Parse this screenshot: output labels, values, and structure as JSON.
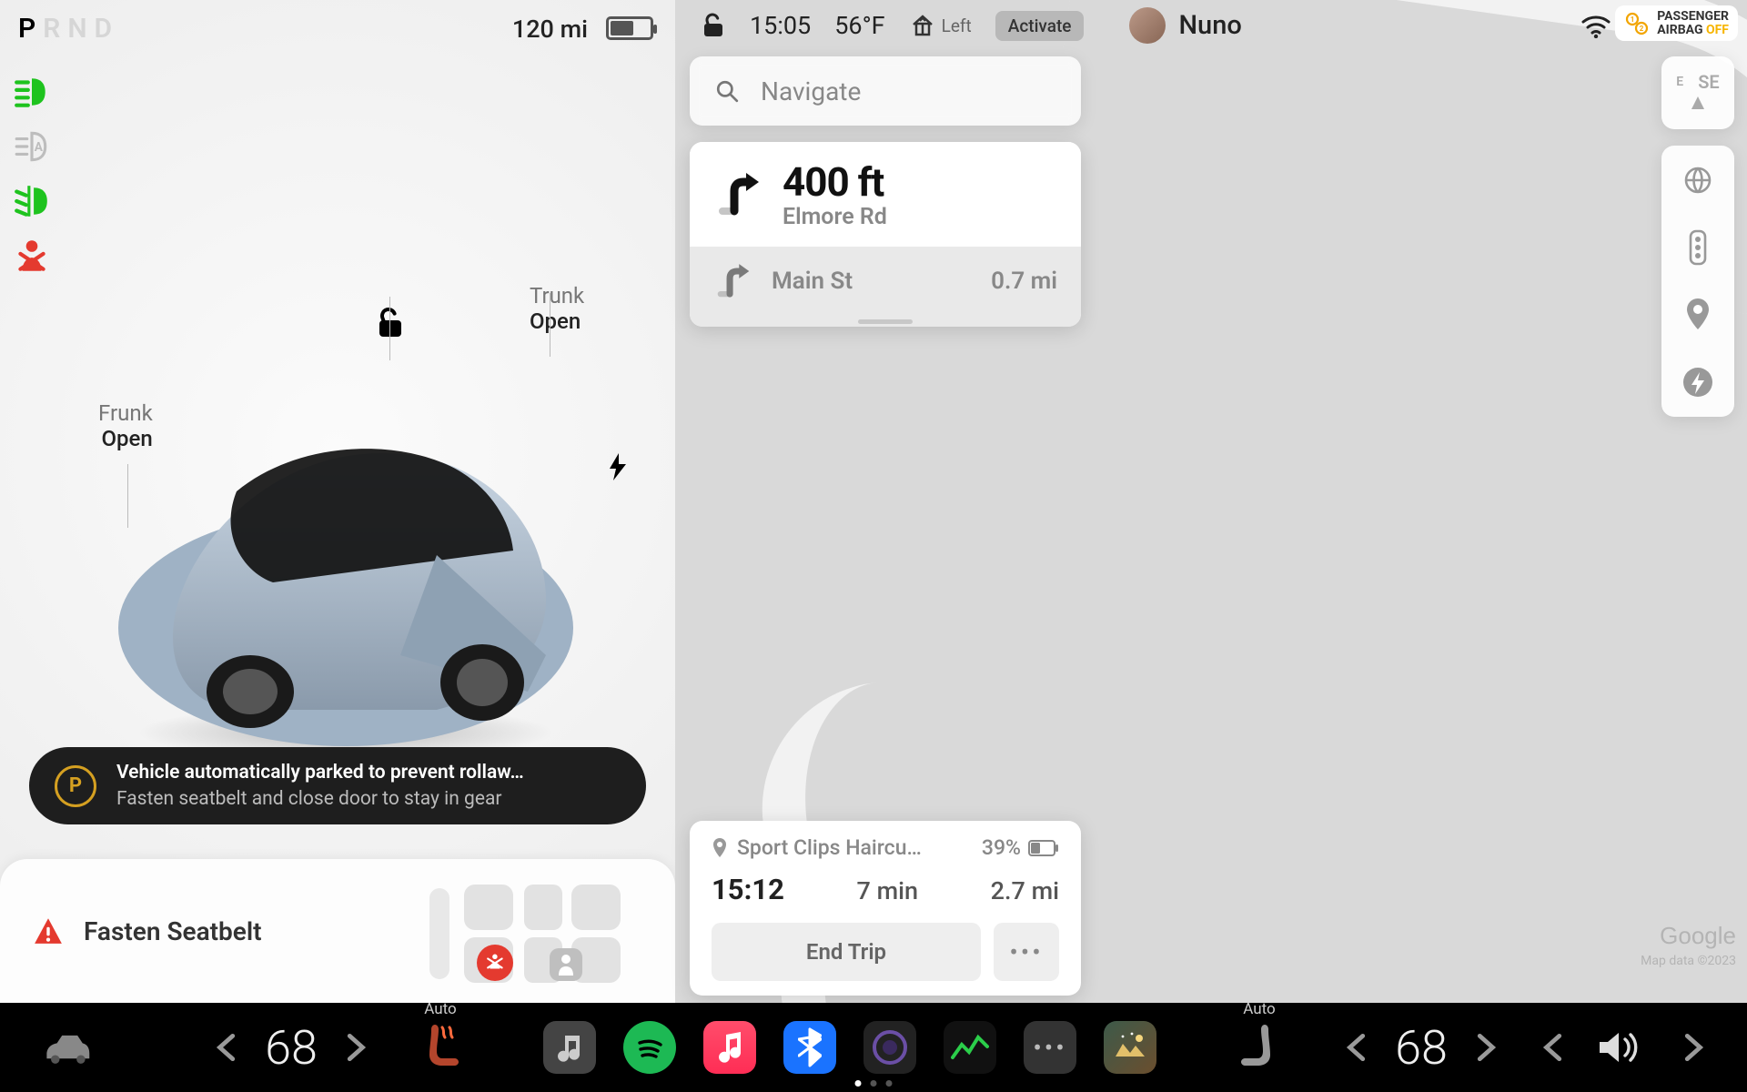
{
  "status": {
    "gears": [
      "P",
      "R",
      "N",
      "D"
    ],
    "gear_selected": "P",
    "range": "120 mi"
  },
  "telltales": {
    "headlight": "on",
    "auto_highbeam": "standby",
    "fog": "on",
    "seatbelt": "warn"
  },
  "car": {
    "frunk_label": "Frunk",
    "frunk_state": "Open",
    "trunk_label": "Trunk",
    "trunk_state": "Open",
    "lock_state": "unlocked"
  },
  "alert": {
    "title": "Vehicle automatically parked to prevent rollaw…",
    "subtitle": "Fasten seatbelt and close door to stay in gear"
  },
  "seatbelt_card": {
    "text": "Fasten Seatbelt"
  },
  "topbar": {
    "time": "15:05",
    "temp": "56°F",
    "homelink_label": "Left",
    "activate": "Activate",
    "user": "Nuno",
    "airbag_line1": "PASSENGER",
    "airbag_line2": "AIRBAG",
    "airbag_state": "OFF"
  },
  "search": {
    "placeholder": "Navigate"
  },
  "nav": {
    "primary_distance": "400 ft",
    "primary_road": "Elmore Rd",
    "secondary_road": "Main St",
    "secondary_distance": "0.7 mi"
  },
  "compass": {
    "heading1": "E",
    "heading2": "SE"
  },
  "trip": {
    "destination": "Sport Clips Haircuts …",
    "arrival_soc": "39%",
    "eta": "15:12",
    "duration": "7 min",
    "distance": "2.7 mi",
    "end_label": "End Trip"
  },
  "map": {
    "credit": "Google",
    "attribution": "Map data ©2023"
  },
  "dock": {
    "left_temp": "68",
    "right_temp": "68",
    "auto_label": "Auto"
  }
}
